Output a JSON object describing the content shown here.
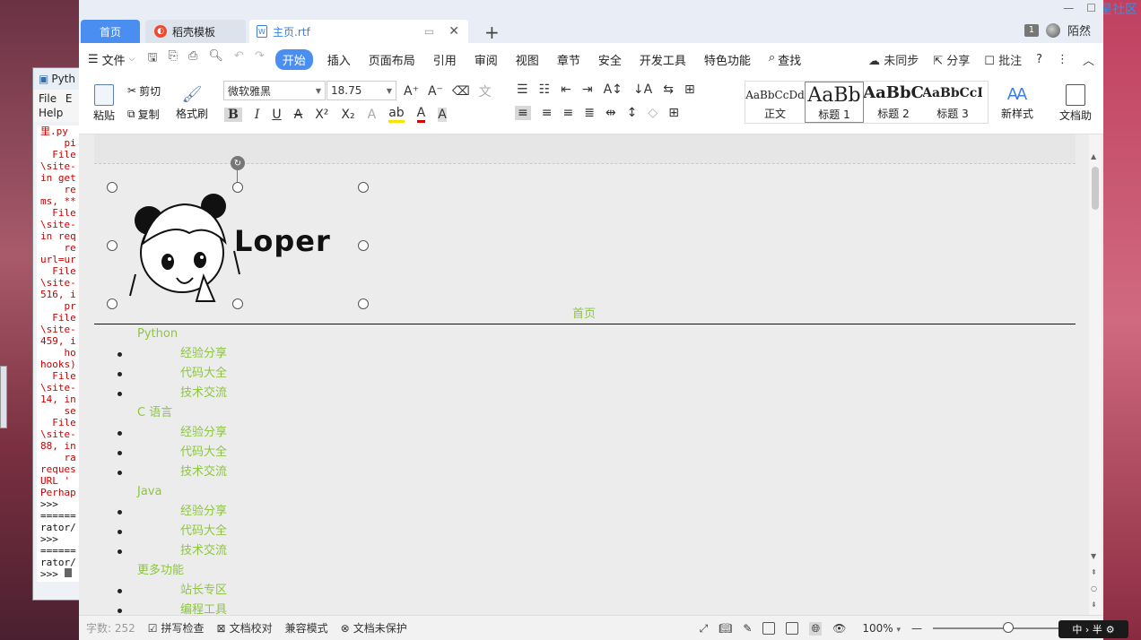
{
  "desktop": {
    "python_window": {
      "title": "Pyth",
      "menu": [
        "File",
        "E",
        "Help"
      ],
      "console_lines": [
        "里.py",
        "    pi",
        "  File",
        "\\site-",
        "in get",
        "    re",
        "ms, **",
        "  File",
        "\\site-",
        "in req",
        "    re",
        "url=ur",
        "  File",
        "\\site-",
        "516, i",
        "    pr",
        "  File",
        "\\site-",
        "459, i",
        "    ho",
        "hooks)",
        "  File",
        "\\site-",
        "14, in",
        "    se",
        "  File",
        "\\site-",
        "88, in",
        "    ra",
        "reques",
        "URL '",
        "Perhap",
        ">>>",
        "======",
        "rator/",
        ">>>",
        "======",
        "rator/",
        ">>> "
      ]
    },
    "community_link": "流星社区"
  },
  "tabs": {
    "home": "首页",
    "daoke": "稻壳模板",
    "doc": "主页.rtf"
  },
  "user": {
    "badge": "1",
    "name": "陌然"
  },
  "menubar": {
    "file": "文件",
    "active": "开始",
    "items": [
      "插入",
      "页面布局",
      "引用",
      "审阅",
      "视图",
      "章节",
      "安全",
      "开发工具",
      "特色功能"
    ],
    "search": "查找",
    "sync": "未同步",
    "share": "分享",
    "comment": "批注"
  },
  "ribbon": {
    "paste": "粘贴",
    "cut": "剪切",
    "copy": "复制",
    "format_painter": "格式刷",
    "font_name": "微软雅黑",
    "font_size": "18.75",
    "styles": [
      {
        "preview": "AaBbCcDd",
        "name": "正文"
      },
      {
        "preview": "AaBb",
        "name": "标题 1"
      },
      {
        "preview": "AaBbC",
        "name": "标题 2"
      },
      {
        "preview": "AaBbCcI",
        "name": "标题 3"
      }
    ],
    "new_style": "新样式",
    "doc_helper": "文档助"
  },
  "document": {
    "logo_text": "Loper",
    "home_link": "首页",
    "nav": [
      {
        "category": "Python",
        "items": [
          "经验分享",
          "代码大全",
          "技术交流"
        ]
      },
      {
        "category": "C 语言",
        "items": [
          "经验分享",
          "代码大全",
          "技术交流"
        ]
      },
      {
        "category": "Java",
        "items": [
          "经验分享",
          "代码大全",
          "技术交流"
        ]
      },
      {
        "category": "更多功能",
        "items": [
          "站长专区",
          "编程工具"
        ]
      }
    ],
    "link_color": "#8cc63f"
  },
  "statusbar": {
    "word_count": "字数: 252",
    "spellcheck": "拼写检查",
    "proofread": "文档校对",
    "compat": "兼容模式",
    "protect": "文档未保护",
    "zoom": "100%",
    "zoom_level": 0.6
  },
  "ime": "中 › 半"
}
